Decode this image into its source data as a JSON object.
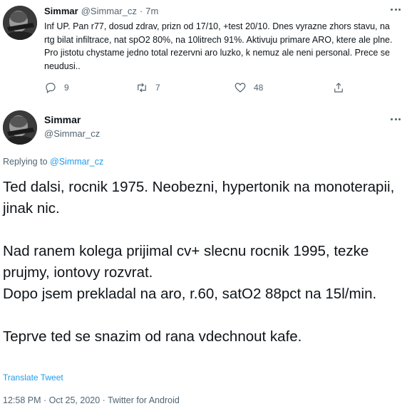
{
  "tweet1": {
    "name": "Simmar",
    "handle": "@Simmar_cz",
    "separator": "·",
    "time": "7m",
    "text": "Inf UP. Pan r77, dosud zdrav, prizn od 17/10, +test 20/10. Dnes vyrazne zhors stavu, na rtg bilat infiltrace, nat spO2 80%, na 10litrech 91%. Aktivuju primare ARO, ktere ale plne. Pro jistotu chystame jedno total rezervni aro luzko, k nemuz ale neni personal. Prece se neudusi..",
    "reply_count": "9",
    "retweet_count": "7",
    "like_count": "48",
    "icons": [
      "reply-icon",
      "retweet-icon",
      "like-icon",
      "share-icon",
      "more-icon"
    ]
  },
  "tweet2": {
    "name": "Simmar",
    "handle": "@Simmar_cz",
    "replying_label": "Replying to",
    "replying_handle": "@Simmar_cz",
    "text": "Ted dalsi, rocnik 1975. Neobezni, hypertonik na monoterapii, jinak nic.\n\nNad ranem kolega prijimal cv+ slecnu rocnik 1995, tezke prujmy, iontovy rozvrat.\nDopo jsem prekladal na aro, r.60, satO2 88pct na 15l/min.\n\nTeprve ted se snazim od rana vdechnout kafe.",
    "translate_label": "Translate Tweet",
    "footer": "12:58 PM · Oct 25, 2020 · Twitter for Android"
  },
  "colors": {
    "link": "#1d9bf0",
    "secondary_text": "#536471",
    "primary_text": "#0f1419"
  }
}
